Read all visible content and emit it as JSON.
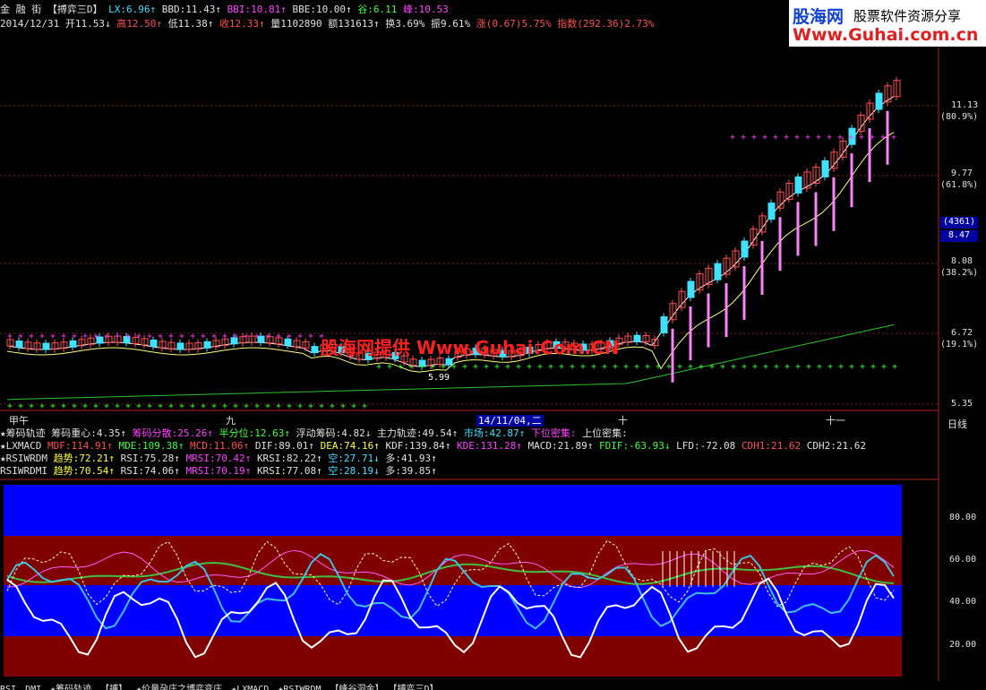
{
  "header": {
    "title": "金 融 街",
    "indicator_name": "【搏弈三D】",
    "line1": [
      {
        "text": "LX:6.96↑",
        "color": "c"
      },
      {
        "text": "BBD:11.43↑",
        "color": "w"
      },
      {
        "text": "BBI:10.81↑",
        "color": "m"
      },
      {
        "text": "BBE:10.00↑",
        "color": "w"
      },
      {
        "text": "谷:6.11",
        "color": "g"
      },
      {
        "text": "峰:10.53",
        "color": "m"
      }
    ],
    "line2": [
      {
        "text": "2014/12/31",
        "color": "w"
      },
      {
        "text": "开11.53↓",
        "color": "w"
      },
      {
        "text": "高12.50↑",
        "color": "r"
      },
      {
        "text": "低11.38↑",
        "color": "w"
      },
      {
        "text": "收12.33↑",
        "color": "r"
      },
      {
        "text": "量1102890",
        "color": "w"
      },
      {
        "text": "额131613↑",
        "color": "w"
      },
      {
        "text": "换3.69%",
        "color": "w"
      },
      {
        "text": "振9.61%",
        "color": "w"
      },
      {
        "text": "涨(0.67)5.75%",
        "color": "r"
      },
      {
        "text": "指数(292.36)2.73%",
        "color": "r"
      }
    ]
  },
  "logo": {
    "name": "股海网",
    "slogan": "股票软件资源分享",
    "url": "Www.Guhai.com.cn"
  },
  "watermark": "股海网提供 Www.Guhai.Com.CN",
  "price_axis": [
    {
      "value": "11.13",
      "pct": "(80.9%)"
    },
    {
      "value": "9.77",
      "pct": "(61.8%)"
    },
    {
      "value": "8.08",
      "pct": "(38.2%)"
    },
    {
      "value": "6.72",
      "pct": "(19.1%)"
    },
    {
      "value": "5.35",
      "pct": ""
    }
  ],
  "volume_badge": "(4361)",
  "price_badge": "8.47",
  "low_marker": "5.99",
  "date_bar": {
    "labels": [
      "甲午",
      "九",
      "十",
      "十一"
    ],
    "cursor_date": "14/11/04,二",
    "period": "日线"
  },
  "indicators": {
    "chip": [
      {
        "text": "★筹码轨迹",
        "color": "w"
      },
      {
        "text": "筹码重心:4.35↑",
        "color": "w"
      },
      {
        "text": "筹码分散:25.26↑",
        "color": "m"
      },
      {
        "text": "半分位:12.63↑",
        "color": "g"
      },
      {
        "text": "浮动筹码:4.82↓",
        "color": "w"
      },
      {
        "text": "主力轨迹:49.54↑",
        "color": "w"
      },
      {
        "text": "市场:42.87↑",
        "color": "c"
      },
      {
        "text": "下位密集:",
        "color": "m"
      },
      {
        "text": "上位密集:",
        "color": "w"
      }
    ],
    "lxmacd": [
      {
        "text": "★LXMACD",
        "color": "w"
      },
      {
        "text": "MDF:114.91↑",
        "color": "r"
      },
      {
        "text": "MDE:109.38↑",
        "color": "g"
      },
      {
        "text": "MCD:11.06↑",
        "color": "r"
      },
      {
        "text": "DIF:89.01↑",
        "color": "w"
      },
      {
        "text": "DEA:74.16↑",
        "color": "y"
      },
      {
        "text": "KDF:139.84↑",
        "color": "w"
      },
      {
        "text": "KDE:131.28↑",
        "color": "m"
      },
      {
        "text": "MACD:21.89↑",
        "color": "w"
      },
      {
        "text": "FDIF:-63.93↓",
        "color": "g"
      },
      {
        "text": "LFD:-72.08",
        "color": "w"
      },
      {
        "text": "CDH1:21.62",
        "color": "r"
      },
      {
        "text": "CDH2:21.62",
        "color": "w"
      }
    ],
    "rsiwrdm": [
      {
        "text": "★RSIWRDM",
        "color": "w"
      },
      {
        "text": "趋势:72.21↑",
        "color": "y"
      },
      {
        "text": "RSI:75.28↑",
        "color": "w"
      },
      {
        "text": "MRSI:70.42↑",
        "color": "m"
      },
      {
        "text": "KRSI:82.22↑",
        "color": "w"
      },
      {
        "text": "空:27.71↓",
        "color": "c"
      },
      {
        "text": "多:41.93↑",
        "color": "w"
      }
    ],
    "rsiwrdmi": [
      {
        "text": "RSIWRDMI",
        "color": "w"
      },
      {
        "text": "趋势:70.54↑",
        "color": "y"
      },
      {
        "text": "RSI:74.06↑",
        "color": "w"
      },
      {
        "text": "MRSI:70.19↑",
        "color": "m"
      },
      {
        "text": "KRSI:77.08↑",
        "color": "w"
      },
      {
        "text": "空:28.19↓",
        "color": "c"
      },
      {
        "text": "多:39.85↑",
        "color": "w"
      }
    ]
  },
  "lower_axis": [
    "80.00",
    "60.00",
    "40.00",
    "20.00"
  ],
  "tabs": [
    "RSI",
    "DMI",
    "★筹码轨迹",
    "【搏】",
    "★价量孕庄之博弈变庄",
    "★LXMACD",
    "★RSIWRDM",
    "【峰谷洞金】",
    "【搏弈三D】"
  ],
  "colors": {
    "bg": "#000000",
    "band_blue": "#0000ff",
    "band_red": "#800000",
    "up": "#ff5050",
    "down": "#40e0ff"
  }
}
